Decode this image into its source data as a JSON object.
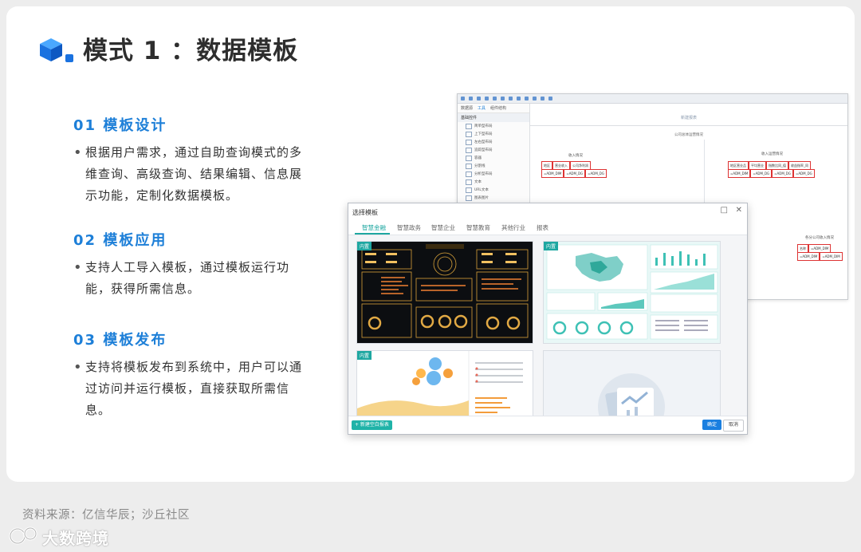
{
  "title": "模式 1 ：数据模板",
  "sections": [
    {
      "heading": "01  模板设计",
      "bullet": "•",
      "body": "根据用户需求，通过自助查询模式的多维查询、高级查询、结果编辑、信息展示功能，定制化数据模板。"
    },
    {
      "heading": "02  模板应用",
      "bullet": "•",
      "body": "支持人工导入模板，通过模板运行功能，获得所需信息。"
    },
    {
      "heading": "03  模板发布",
      "bullet": "•",
      "body": "支持将模板发布到系统中，用户可以通过访问并运行模板，直接获取所需信息。"
    }
  ],
  "designer": {
    "side_tabs": [
      "数据源",
      "工具",
      "组件结构"
    ],
    "group": "基础控件",
    "items": [
      "简单型布局",
      "上下型布局",
      "左右型布局",
      "追踪型布局",
      "容器",
      "分割线",
      "分析型布局",
      "文本",
      "URL文本",
      "图表图片"
    ],
    "canvas_tab": "新建报表",
    "canvas_subtitle": "公司总体运营情况",
    "left_header": "收入情况",
    "right_header": "收入运营情况",
    "left_cols": [
      "地区",
      "营业收入",
      "公司净利润"
    ],
    "left_vals": [
      "=ADM_DIM",
      "=ADM_DG",
      "=ADM_DG"
    ],
    "right_cols": [
      "地区营业品",
      "平均营业",
      "指数比同_值",
      "收益指率_同"
    ],
    "right_vals": [
      "=ADM_DIM",
      "=ADM_DG",
      "=ADM_DG",
      "=ADM_DG"
    ],
    "bottom_header": "各分公司收入情况",
    "bottom_cols": [
      "名称",
      "=ADM_DIM"
    ],
    "bottom_vals": [
      "=ADM_DIM",
      "=ADM_DIM"
    ]
  },
  "dialog": {
    "title": "选择模板",
    "maximize": "□",
    "close": "✕",
    "tabs": [
      "智慧金融",
      "智慧政务",
      "智慧企业",
      "智慧教育",
      "其他行业",
      "报表"
    ],
    "badge": "内置",
    "new_button": "+ 新建空白报表",
    "ok": "确定",
    "cancel": "取消"
  },
  "source": "资料来源：亿信华辰；沙丘社区",
  "watermark": "大数跨境",
  "colors": {
    "accent_blue": "#1d7fd8",
    "teal": "#1ea7a1",
    "primary_button": "#1a7fe0"
  }
}
